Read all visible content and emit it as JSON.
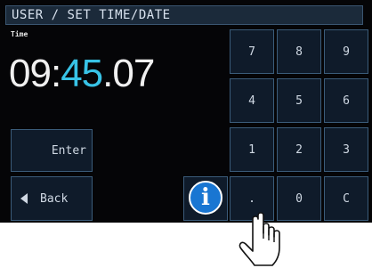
{
  "header": {
    "title": "USER / SET TIME/DATE"
  },
  "time": {
    "label": "Time",
    "hours": "09",
    "sep1": ":",
    "minutes": "45",
    "sep2": ".",
    "seconds": "07"
  },
  "buttons": {
    "enter": "Enter",
    "back": "Back",
    "info": "i"
  },
  "keypad": {
    "row1": [
      "7",
      "8",
      "9"
    ],
    "row2": [
      "4",
      "5",
      "6"
    ],
    "row3": [
      "1",
      "2",
      "3"
    ],
    "row4": [
      ".",
      "0",
      "C"
    ]
  },
  "colors": {
    "accent": "#38c3e6",
    "info": "#1976d2",
    "button_border": "#3b5c7a"
  },
  "icons": [
    "back-arrow-icon",
    "info-icon",
    "hand-pointer-icon"
  ]
}
